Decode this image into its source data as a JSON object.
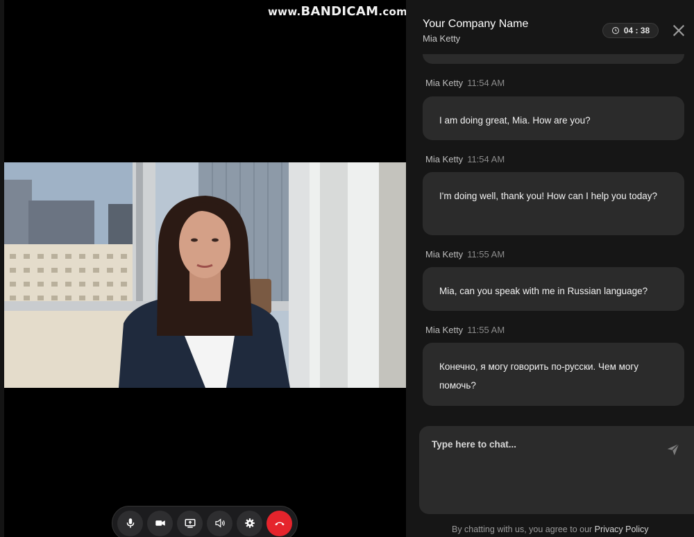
{
  "watermark": {
    "prefix": "www.",
    "brand": "BANDICAM",
    "suffix": ".com"
  },
  "chat": {
    "company_name": "Your Company Name",
    "agent_name": "Mia Ketty",
    "timer": "04 : 38",
    "messages": [
      {
        "sender": "Mia Ketty",
        "time": "11:54 AM",
        "text": "I am doing great, Mia. How are you?"
      },
      {
        "sender": "Mia Ketty",
        "time": "11:54 AM",
        "text": "I'm doing well, thank you!  How can I help you today?"
      },
      {
        "sender": "Mia Ketty",
        "time": "11:55 AM",
        "text": "Mia, can you speak with me in Russian language?"
      },
      {
        "sender": "Mia Ketty",
        "time": "11:55 AM",
        "text": "Конечно, я могу говорить по-русски.  Чем могу помочь?"
      }
    ],
    "input_placeholder": "Type here to chat...",
    "footer_text": "By chatting with us, you agree to our ",
    "footer_link": "Privacy Policy"
  },
  "controls": [
    {
      "icon": "microphone-icon"
    },
    {
      "icon": "camera-icon"
    },
    {
      "icon": "screen-share-icon"
    },
    {
      "icon": "speaker-icon"
    },
    {
      "icon": "gear-icon"
    },
    {
      "icon": "end-call-icon",
      "color": "#e5242c"
    }
  ],
  "colors": {
    "panel": "#161616",
    "bubble": "#2b2b2b",
    "end_call": "#e5242c"
  }
}
